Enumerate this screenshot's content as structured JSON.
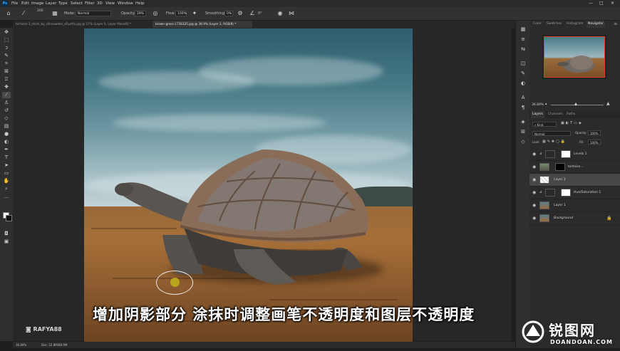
{
  "menu": {
    "logo": "Ps",
    "items": [
      "File",
      "Edit",
      "Image",
      "Layer",
      "Type",
      "Select",
      "Filter",
      "3D",
      "View",
      "Window",
      "Help"
    ],
    "window_controls": [
      "—",
      "□",
      "✕"
    ]
  },
  "options_bar": {
    "brush_size": "200",
    "mode_label": "Mode:",
    "mode_value": "Normal",
    "opacity_label": "Opacity:",
    "opacity_value": "29%",
    "flow_label": "Flow:",
    "flow_value": "100%",
    "smoothing_label": "Smoothing:",
    "smoothing_value": "0%",
    "angle_value": "0°"
  },
  "tabs": [
    {
      "label": "tortoise-3_stock_by_silhouwebs_d1yxtfo.jpg @ 17% (Layer 0, Layer Mask/8) *",
      "active": false
    },
    {
      "label": "brown-grass-1756325.jpg @ 36.9% (Layer 2, RGB/8) *",
      "active": true
    }
  ],
  "subtitle": "增加阴影部分 涂抹时调整画笔不透明度和图层不透明度",
  "watermark_left": "RAFYA88",
  "status": {
    "zoom": "36.89%",
    "doc": "Doc: 22.8M/89.9M"
  },
  "panels": {
    "top_tabs": [
      "Color",
      "Swatches",
      "Histogram",
      "Navigator"
    ],
    "active_top_tab": "Navigator",
    "navigator_zoom": "36.89%",
    "layer_tabs": [
      "Layers",
      "Channels",
      "Paths"
    ],
    "active_layer_tab": "Layers",
    "filter_kind": "Kind",
    "blend_mode": "Normal",
    "opacity_label": "Opacity:",
    "opacity_value": "100%",
    "lock_label": "Lock:",
    "fill_label": "Fill:",
    "fill_value": "100%",
    "layers": [
      {
        "name": "Levels 1",
        "selected": false
      },
      {
        "name": "tortoise...",
        "selected": false
      },
      {
        "name": "Layer 2",
        "selected": true
      },
      {
        "name": "Hue/Saturation 1",
        "selected": false
      },
      {
        "name": "Layer 1",
        "selected": false
      },
      {
        "name": "Background",
        "selected": false
      }
    ]
  },
  "brand": {
    "text_cn": "锐图网",
    "text_en": "DOANDOAN.COM"
  },
  "colors": {
    "accent_blue": "#31a8ff",
    "navigator_frame": "#e0402a",
    "cursor_dot": "#b9a41d"
  },
  "icons": [
    "home-icon",
    "brush-icon",
    "airbrush-icon",
    "angle-icon",
    "pressure-icon",
    "symmetry-icon",
    "move-icon",
    "marquee-icon",
    "lasso-icon",
    "quick-select-icon",
    "crop-icon",
    "eyedropper-icon",
    "healing-icon",
    "brush-tool-icon",
    "stamp-icon",
    "history-brush-icon",
    "eraser-icon",
    "gradient-icon",
    "blur-icon",
    "dodge-icon",
    "pen-icon",
    "type-icon",
    "path-select-icon",
    "shape-icon",
    "hand-icon",
    "zoom-icon",
    "eye-icon"
  ]
}
